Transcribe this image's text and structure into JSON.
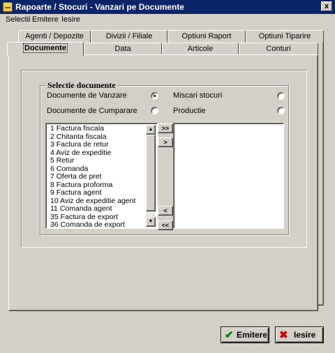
{
  "window": {
    "title": "Rapoarte / Stocuri - Vanzari pe Documente",
    "close": "x"
  },
  "menu": [
    "Selectii",
    "Emitere",
    "Iesire"
  ],
  "tabs_row1": [
    "Agenti / Depozite",
    "Divizii / Filiale",
    "Optiuni Raport",
    "Optiuni Tiparire"
  ],
  "tabs_row2": [
    "Documente",
    "Data",
    "Articole",
    "Conturi"
  ],
  "group": {
    "legend": "Selectie documente",
    "options": [
      {
        "label": "Documente de Vanzare",
        "checked": true
      },
      {
        "label": "Documente de Cumparare",
        "checked": false
      },
      {
        "label": "Miscari stocuri",
        "checked": false
      },
      {
        "label": "Productie",
        "checked": false
      }
    ]
  },
  "documents": [
    "1 Factura fiscala",
    "2 Chitanta fiscala",
    "3 Factura de retur",
    "4 Aviz de expeditie",
    "5 Retur",
    "6 Comanda",
    "7 Oferta de pret",
    "8 Factura proforma",
    "9 Factura agent",
    "10 Aviz de expeditie agent",
    "11 Comanda agent",
    "35 Factura de export",
    "36 Comanda de export"
  ],
  "move_buttons": {
    "add_all": ">>",
    "add": ">",
    "remove": "<",
    "remove_all": "<<"
  },
  "scroll": {
    "up": "▲",
    "down": "▼"
  },
  "buttons": {
    "emitere": "Emitere",
    "iesire": "Iesire"
  },
  "icons": {
    "title": "app-icon",
    "emitere": "checkmark-icon",
    "iesire": "x-icon"
  },
  "colors": {
    "titlebar": "#0a246a",
    "face": "#d4d0c8",
    "check": "#008000",
    "x": "#d00000"
  }
}
